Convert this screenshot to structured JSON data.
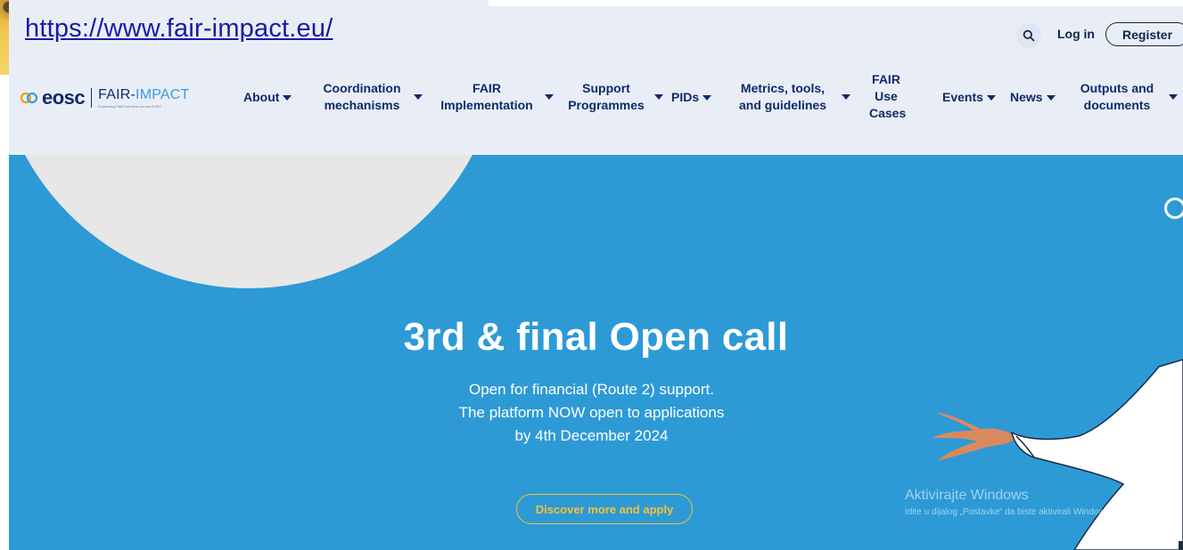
{
  "overlay_url": "https://www.fair-impact.eu/",
  "header": {
    "login_label": "Log in",
    "register_label": "Register",
    "search_icon": "search-icon"
  },
  "logo": {
    "eosc_text": "eosc",
    "fair_text": "FAIR-",
    "impact_text": "IMPACT",
    "tagline": "Expanding FAIR solutions across EOSC"
  },
  "nav": {
    "items": [
      {
        "label": "About"
      },
      {
        "label": "Coordination mechanisms"
      },
      {
        "label": "FAIR Implementation"
      },
      {
        "label": "Support Programmes"
      },
      {
        "label": "PIDs"
      },
      {
        "label": "Metrics, tools, and guidelines"
      },
      {
        "label": "FAIR Use Cases"
      },
      {
        "label": "Events"
      },
      {
        "label": "News"
      },
      {
        "label": "Outputs and documents"
      }
    ]
  },
  "hero": {
    "title": "3rd & final Open call",
    "line1": "Open for financial (Route 2) support.",
    "line2": "The platform NOW open to applications",
    "line3": "by 4th December 2024",
    "cta_label": "Discover more and apply"
  },
  "watermark": {
    "title": "Aktivirajte Windows",
    "subtitle": "Idite u dijalog „Postavke“ da biste aktivirali Windows."
  },
  "colors": {
    "header_bg": "#e9eef6",
    "hero_bg": "#2d9ad6",
    "brand_navy": "#0e2a6a",
    "cta_yellow": "#f5c234"
  }
}
